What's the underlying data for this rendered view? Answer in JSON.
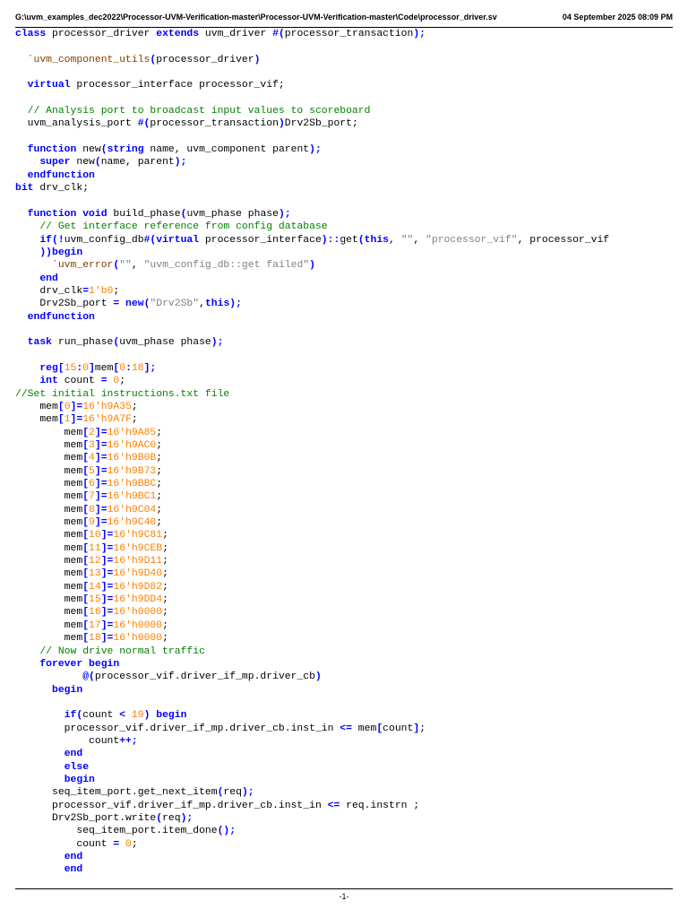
{
  "header": {
    "file_path": "G:\\uvm_examples_dec2022\\Processor-UVM-Verification-master\\Processor-UVM-Verification-master\\Code\\processor_driver.sv",
    "printed_date": "04 September 2025 08:09 PM"
  },
  "footer": {
    "page_number": "-1-"
  },
  "code_lines": [
    [
      [
        "kw",
        "class"
      ],
      [
        "",
        "processor_driver "
      ],
      [
        "kw",
        "extends"
      ],
      [
        "",
        "uvm_driver "
      ],
      [
        "op",
        "#("
      ],
      [
        "",
        "processor_transaction"
      ],
      [
        "op",
        ");"
      ]
    ],
    [],
    [
      [
        "",
        "  "
      ],
      [
        "mac",
        "`uvm_component_utils"
      ],
      [
        "op",
        "("
      ],
      [
        "",
        "processor_driver"
      ],
      [
        "op",
        ")"
      ]
    ],
    [],
    [
      [
        "",
        "  "
      ],
      [
        "kw",
        "virtual"
      ],
      [
        "",
        "processor_interface processor_vif;"
      ]
    ],
    [],
    [
      [
        "",
        "  "
      ],
      [
        "cm",
        "// Analysis port to broadcast input values to scoreboard"
      ]
    ],
    [
      [
        "",
        "  uvm_analysis_port "
      ],
      [
        "op",
        "#("
      ],
      [
        "",
        "processor_transaction"
      ],
      [
        "op",
        ")"
      ],
      [
        "",
        "Drv2Sb_port;"
      ]
    ],
    [],
    [
      [
        "",
        "  "
      ],
      [
        "kw",
        "function"
      ],
      [
        "",
        "new"
      ],
      [
        "op",
        "("
      ],
      [
        "kw",
        "string"
      ],
      [
        "",
        "name, uvm_component parent"
      ],
      [
        "op",
        ");"
      ]
    ],
    [
      [
        "",
        "    "
      ],
      [
        "kw",
        "super"
      ],
      [
        "",
        "new"
      ],
      [
        "op",
        "("
      ],
      [
        "",
        "name, parent"
      ],
      [
        "op",
        ");"
      ]
    ],
    [
      [
        "",
        "  "
      ],
      [
        "kw",
        "endfunction"
      ]
    ],
    [
      [
        "kw",
        "bit"
      ],
      [
        "",
        "drv_clk;"
      ]
    ],
    [],
    [
      [
        "",
        "  "
      ],
      [
        "kw",
        "function"
      ],
      [
        "kw",
        "void"
      ],
      [
        "",
        "build_phase"
      ],
      [
        "op",
        "("
      ],
      [
        "",
        "uvm_phase phase"
      ],
      [
        "op",
        ");"
      ]
    ],
    [
      [
        "",
        "    "
      ],
      [
        "cm",
        "// Get interface reference from config database"
      ]
    ],
    [
      [
        "",
        "    "
      ],
      [
        "kw",
        "if"
      ],
      [
        "op",
        "(!"
      ],
      [
        "",
        "uvm_config_db"
      ],
      [
        "op",
        "#("
      ],
      [
        "kw",
        "virtual"
      ],
      [
        "",
        "processor_interface"
      ],
      [
        "op",
        ")::"
      ],
      [
        "",
        "get"
      ],
      [
        "op",
        "("
      ],
      [
        "kw",
        "this"
      ],
      [
        "",
        ", "
      ],
      [
        "str",
        "\"\""
      ],
      [
        "",
        ", "
      ],
      [
        "str",
        "\"processor_vif\""
      ],
      [
        "",
        ", processor_vif"
      ]
    ],
    [
      [
        "",
        "    "
      ],
      [
        "op",
        "))"
      ],
      [
        "kw",
        "begin"
      ]
    ],
    [
      [
        "",
        "      "
      ],
      [
        "mac",
        "`uvm_error"
      ],
      [
        "op",
        "("
      ],
      [
        "str",
        "\"\""
      ],
      [
        "",
        ", "
      ],
      [
        "str",
        "\"uvm_config_db::get failed\""
      ],
      [
        "op",
        ")"
      ]
    ],
    [
      [
        "",
        "    "
      ],
      [
        "kw",
        "end"
      ]
    ],
    [
      [
        "",
        "    drv_clk"
      ],
      [
        "op",
        "="
      ],
      [
        "num",
        "1'b0"
      ],
      [
        "",
        ";"
      ]
    ],
    [
      [
        "",
        "    Drv2Sb_port "
      ],
      [
        "op",
        "= "
      ],
      [
        "kw",
        "new"
      ],
      [
        "op",
        "("
      ],
      [
        "str",
        "\"Drv2Sb\""
      ],
      [
        "",
        ","
      ],
      [
        "kw",
        "this"
      ],
      [
        "op",
        ");"
      ]
    ],
    [
      [
        "",
        "  "
      ],
      [
        "kw",
        "endfunction"
      ]
    ],
    [],
    [
      [
        "",
        "  "
      ],
      [
        "kw",
        "task"
      ],
      [
        "",
        "run_phase"
      ],
      [
        "op",
        "("
      ],
      [
        "",
        "uvm_phase phase"
      ],
      [
        "op",
        ");"
      ]
    ],
    [],
    [
      [
        "",
        "    "
      ],
      [
        "kw",
        "reg"
      ],
      [
        "op",
        "["
      ],
      [
        "num",
        "15"
      ],
      [
        "op",
        ":"
      ],
      [
        "num",
        "0"
      ],
      [
        "op",
        "]"
      ],
      [
        "",
        "mem"
      ],
      [
        "op",
        "["
      ],
      [
        "num",
        "0"
      ],
      [
        "op",
        ":"
      ],
      [
        "num",
        "18"
      ],
      [
        "op",
        "];"
      ]
    ],
    [
      [
        "",
        "    "
      ],
      [
        "kw",
        "int"
      ],
      [
        "",
        "count "
      ],
      [
        "op",
        "= "
      ],
      [
        "num",
        "0"
      ],
      [
        "",
        ";"
      ]
    ],
    [
      [
        "cm",
        "//Set initial instructions.txt file"
      ]
    ],
    [
      [
        "",
        "    mem"
      ],
      [
        "op",
        "["
      ],
      [
        "num",
        "0"
      ],
      [
        "op",
        "]="
      ],
      [
        "num",
        "16'h9A35"
      ],
      [
        "",
        ";"
      ]
    ],
    [
      [
        "",
        "    mem"
      ],
      [
        "op",
        "["
      ],
      [
        "num",
        "1"
      ],
      [
        "op",
        "]="
      ],
      [
        "num",
        "16'h9A7F"
      ],
      [
        "",
        ";"
      ]
    ],
    [
      [
        "",
        "        mem"
      ],
      [
        "op",
        "["
      ],
      [
        "num",
        "2"
      ],
      [
        "op",
        "]="
      ],
      [
        "num",
        "16'h9A85"
      ],
      [
        "",
        ";"
      ]
    ],
    [
      [
        "",
        "        mem"
      ],
      [
        "op",
        "["
      ],
      [
        "num",
        "3"
      ],
      [
        "op",
        "]="
      ],
      [
        "num",
        "16'h9AC0"
      ],
      [
        "",
        ";"
      ]
    ],
    [
      [
        "",
        "        mem"
      ],
      [
        "op",
        "["
      ],
      [
        "num",
        "4"
      ],
      [
        "op",
        "]="
      ],
      [
        "num",
        "16'h9B0B"
      ],
      [
        "",
        ";"
      ]
    ],
    [
      [
        "",
        "        mem"
      ],
      [
        "op",
        "["
      ],
      [
        "num",
        "5"
      ],
      [
        "op",
        "]="
      ],
      [
        "num",
        "16'h9B73"
      ],
      [
        "",
        ";"
      ]
    ],
    [
      [
        "",
        "        mem"
      ],
      [
        "op",
        "["
      ],
      [
        "num",
        "6"
      ],
      [
        "op",
        "]="
      ],
      [
        "num",
        "16'h9BBC"
      ],
      [
        "",
        ";"
      ]
    ],
    [
      [
        "",
        "        mem"
      ],
      [
        "op",
        "["
      ],
      [
        "num",
        "7"
      ],
      [
        "op",
        "]="
      ],
      [
        "num",
        "16'h9BC1"
      ],
      [
        "",
        ";"
      ]
    ],
    [
      [
        "",
        "        mem"
      ],
      [
        "op",
        "["
      ],
      [
        "num",
        "8"
      ],
      [
        "op",
        "]="
      ],
      [
        "num",
        "16'h9C04"
      ],
      [
        "",
        ";"
      ]
    ],
    [
      [
        "",
        "        mem"
      ],
      [
        "op",
        "["
      ],
      [
        "num",
        "9"
      ],
      [
        "op",
        "]="
      ],
      [
        "num",
        "16'h9C40"
      ],
      [
        "",
        ";"
      ]
    ],
    [
      [
        "",
        "        mem"
      ],
      [
        "op",
        "["
      ],
      [
        "num",
        "10"
      ],
      [
        "op",
        "]="
      ],
      [
        "num",
        "16'h9C81"
      ],
      [
        "",
        ";"
      ]
    ],
    [
      [
        "",
        "        mem"
      ],
      [
        "op",
        "["
      ],
      [
        "num",
        "11"
      ],
      [
        "op",
        "]="
      ],
      [
        "num",
        "16'h9CEB"
      ],
      [
        "",
        ";"
      ]
    ],
    [
      [
        "",
        "        mem"
      ],
      [
        "op",
        "["
      ],
      [
        "num",
        "12"
      ],
      [
        "op",
        "]="
      ],
      [
        "num",
        "16'h9D11"
      ],
      [
        "",
        ";"
      ]
    ],
    [
      [
        "",
        "        mem"
      ],
      [
        "op",
        "["
      ],
      [
        "num",
        "13"
      ],
      [
        "op",
        "]="
      ],
      [
        "num",
        "16'h9D40"
      ],
      [
        "",
        ";"
      ]
    ],
    [
      [
        "",
        "        mem"
      ],
      [
        "op",
        "["
      ],
      [
        "num",
        "14"
      ],
      [
        "op",
        "]="
      ],
      [
        "num",
        "16'h9D82"
      ],
      [
        "",
        ";"
      ]
    ],
    [
      [
        "",
        "        mem"
      ],
      [
        "op",
        "["
      ],
      [
        "num",
        "15"
      ],
      [
        "op",
        "]="
      ],
      [
        "num",
        "16'h9DD4"
      ],
      [
        "",
        ";"
      ]
    ],
    [
      [
        "",
        "        mem"
      ],
      [
        "op",
        "["
      ],
      [
        "num",
        "16"
      ],
      [
        "op",
        "]="
      ],
      [
        "num",
        "16'h0000"
      ],
      [
        "",
        ";"
      ]
    ],
    [
      [
        "",
        "        mem"
      ],
      [
        "op",
        "["
      ],
      [
        "num",
        "17"
      ],
      [
        "op",
        "]="
      ],
      [
        "num",
        "16'h0000"
      ],
      [
        "",
        ";"
      ]
    ],
    [
      [
        "",
        "        mem"
      ],
      [
        "op",
        "["
      ],
      [
        "num",
        "18"
      ],
      [
        "op",
        "]="
      ],
      [
        "num",
        "16'h0000"
      ],
      [
        "",
        ";"
      ]
    ],
    [
      [
        "",
        "    "
      ],
      [
        "cm",
        "// Now drive normal traffic"
      ]
    ],
    [
      [
        "",
        "    "
      ],
      [
        "kw",
        "forever begin"
      ]
    ],
    [
      [
        "",
        "           "
      ],
      [
        "op",
        "@("
      ],
      [
        "",
        "processor_vif.driver_if_mp.driver_cb"
      ],
      [
        "op",
        ")"
      ]
    ],
    [
      [
        "",
        "      "
      ],
      [
        "kw",
        "begin"
      ]
    ],
    [],
    [
      [
        "",
        "        "
      ],
      [
        "kw",
        "if"
      ],
      [
        "op",
        "("
      ],
      [
        "",
        "count "
      ],
      [
        "op",
        "< "
      ],
      [
        "num",
        "19"
      ],
      [
        "op",
        ") "
      ],
      [
        "kw",
        "begin"
      ]
    ],
    [
      [
        "",
        "        processor_vif.driver_if_mp.driver_cb.inst_in "
      ],
      [
        "op",
        "<= "
      ],
      [
        "",
        "mem"
      ],
      [
        "op",
        "["
      ],
      [
        "",
        "count"
      ],
      [
        "op",
        "]"
      ],
      [
        "",
        ";"
      ]
    ],
    [
      [
        "",
        "            count"
      ],
      [
        "op",
        "++;"
      ]
    ],
    [
      [
        "",
        "        "
      ],
      [
        "kw",
        "end"
      ]
    ],
    [
      [
        "",
        "        "
      ],
      [
        "kw",
        "else"
      ]
    ],
    [
      [
        "",
        "        "
      ],
      [
        "kw",
        "begin"
      ]
    ],
    [
      [
        "",
        "      seq_item_port.get_next_item"
      ],
      [
        "op",
        "("
      ],
      [
        "",
        "req"
      ],
      [
        "op",
        ");"
      ]
    ],
    [
      [
        "",
        "      processor_vif.driver_if_mp.driver_cb.inst_in "
      ],
      [
        "op",
        "<= "
      ],
      [
        "",
        "req.instrn ;"
      ]
    ],
    [
      [
        "",
        "      Drv2Sb_port.write"
      ],
      [
        "op",
        "("
      ],
      [
        "",
        "req"
      ],
      [
        "op",
        ");"
      ]
    ],
    [
      [
        "",
        "          seq_item_port.item_done"
      ],
      [
        "op",
        "();"
      ]
    ],
    [
      [
        "",
        "          count "
      ],
      [
        "op",
        "= "
      ],
      [
        "num",
        "0"
      ],
      [
        "",
        ";"
      ]
    ],
    [
      [
        "",
        "        "
      ],
      [
        "kw",
        "end"
      ]
    ],
    [
      [
        "",
        "        "
      ],
      [
        "kw",
        "end"
      ]
    ]
  ]
}
